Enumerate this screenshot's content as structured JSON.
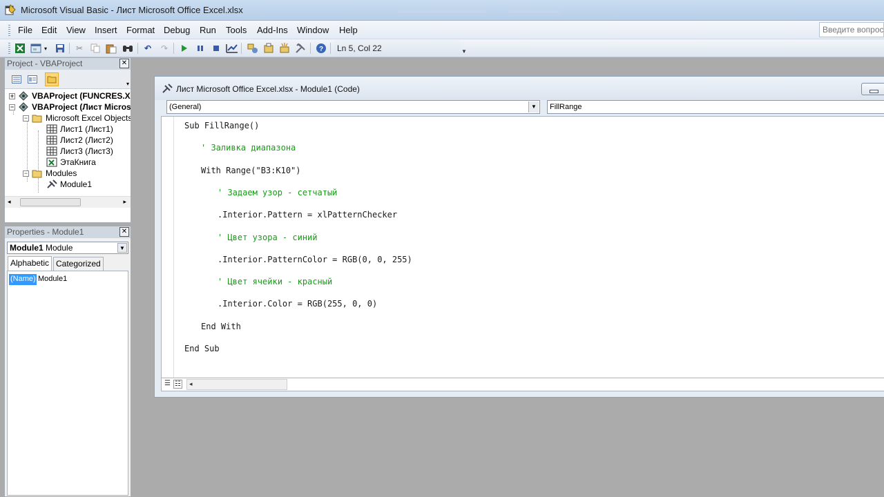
{
  "window": {
    "title": "Microsoft Visual Basic - Лист Microsoft Office Excel.xlsx"
  },
  "menu": {
    "items": [
      "File",
      "Edit",
      "View",
      "Insert",
      "Format",
      "Debug",
      "Run",
      "Tools",
      "Add-Ins",
      "Window",
      "Help"
    ],
    "help_search_placeholder": "Введите вопрос"
  },
  "toolbar": {
    "cursor_position": "Ln 5, Col 22",
    "icons": [
      "excel-icon",
      "insert-userform-icon",
      "save-icon",
      "cut-icon",
      "copy-icon",
      "paste-icon",
      "find-icon",
      "undo-icon",
      "redo-icon",
      "run-icon",
      "break-icon",
      "reset-icon",
      "design-mode-icon",
      "project-explorer-icon",
      "properties-icon",
      "object-browser-icon",
      "toolbox-icon",
      "help-icon"
    ]
  },
  "project_pane": {
    "title": "Project - VBAProject",
    "close": "✕",
    "tree": {
      "project1": "VBAProject (FUNCRES.XL",
      "project2": "VBAProject (Лист Micros",
      "excel_objects": "Microsoft Excel Objects",
      "sheet1": "Лист1 (Лист1)",
      "sheet2": "Лист2 (Лист2)",
      "sheet3": "Лист3 (Лист3)",
      "workbook": "ЭтаКнига",
      "modules": "Modules",
      "module1": "Module1"
    }
  },
  "properties_pane": {
    "title": "Properties - Module1",
    "close": "✕",
    "object_bold": "Module1",
    "object_type": "Module",
    "tabs": [
      "Alphabetic",
      "Categorized"
    ],
    "rows": [
      {
        "name": "(Name)",
        "value": "Module1"
      }
    ]
  },
  "code_window": {
    "title": "Лист Microsoft Office Excel.xlsx - Module1 (Code)",
    "object_combo": "(General)",
    "procedure_combo": "FillRange",
    "lines": [
      {
        "text": "Sub FillRange()",
        "type": "code"
      },
      {
        "text": "' Заливка диапазона",
        "type": "comment"
      },
      {
        "text": "With Range(\"B3:K10\")",
        "type": "code"
      },
      {
        "text": "' Задаем узор - сетчатый",
        "type": "comment"
      },
      {
        "text": ".Interior.Pattern = xlPatternChecker",
        "type": "code"
      },
      {
        "text": "' Цвет узора - синий",
        "type": "comment"
      },
      {
        "text": ".Interior.PatternColor = RGB(0, 0, 255)",
        "type": "code"
      },
      {
        "text": "' Цвет ячейки - красный",
        "type": "comment"
      },
      {
        "text": ".Interior.Color = RGB(255, 0, 0)",
        "type": "code"
      },
      {
        "text": "End With",
        "type": "code"
      },
      {
        "text": "End Sub",
        "type": "code"
      }
    ]
  },
  "colors": {
    "comment": "#189a18",
    "title_bar": "#c9dcf0",
    "selection": "#3399ff"
  }
}
